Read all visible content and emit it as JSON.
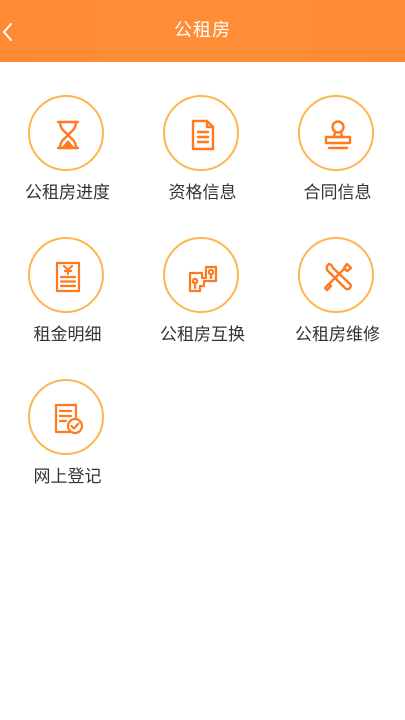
{
  "header": {
    "title": "公租房",
    "background_color": "#ff8a35",
    "back_icon": "chevron-left-icon"
  },
  "menu": {
    "accent_color": "#ff7a1f",
    "ring_color": "#ffb54d",
    "items": [
      {
        "label": "公租房进度",
        "icon": "hourglass-icon"
      },
      {
        "label": "资格信息",
        "icon": "document-icon"
      },
      {
        "label": "合同信息",
        "icon": "stamp-icon"
      },
      {
        "label": "租金明细",
        "icon": "receipt-icon"
      },
      {
        "label": "公租房互换",
        "icon": "key-swap-icon"
      },
      {
        "label": "公租房维修",
        "icon": "repair-tools-icon"
      },
      {
        "label": "网上登记",
        "icon": "register-check-icon"
      }
    ]
  }
}
